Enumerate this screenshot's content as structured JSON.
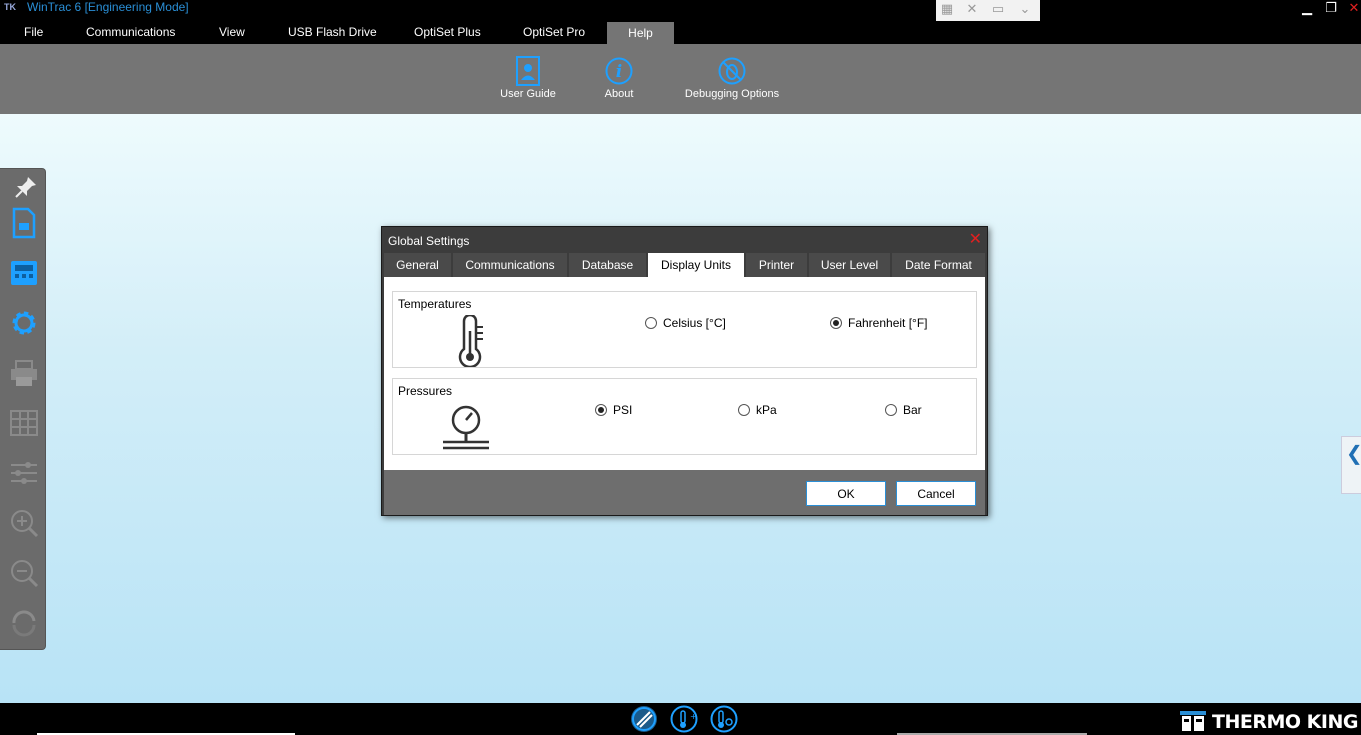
{
  "window": {
    "title": "WinTrac 6 [Engineering Mode]",
    "logo": "TK",
    "quick_access": [
      "grid-icon",
      "fullscreen-icon",
      "monitor-icon",
      "chevron-down-icon"
    ],
    "controls": {
      "minimize": "▁",
      "maximize": "❐",
      "close": "✕"
    }
  },
  "menu": {
    "items": [
      "File",
      "Communications",
      "View",
      "USB Flash Drive",
      "OptiSet Plus",
      "OptiSet Pro",
      "Help"
    ],
    "active": "Help"
  },
  "ribbon": {
    "buttons": [
      {
        "label": "User Guide",
        "icon": "user-guide-icon"
      },
      {
        "label": "About",
        "icon": "info-icon"
      },
      {
        "label": "Debugging Options",
        "icon": "bug-icon"
      }
    ]
  },
  "toolpanel": {
    "tools": [
      "pin-icon",
      "document-icon",
      "device-icon",
      "settings-icon",
      "printer-icon",
      "grid-icon",
      "sliders-icon",
      "zoom-in-icon",
      "zoom-out-icon",
      "refresh-icon"
    ]
  },
  "dialog": {
    "title": "Global Settings",
    "close": "✕",
    "tabs": [
      "General",
      "Communications",
      "Database",
      "Display Units",
      "Printer",
      "User Level",
      "Date Format"
    ],
    "active_tab": "Display Units",
    "temperatures": {
      "label": "Temperatures",
      "icon": "thermometer-icon",
      "options": [
        {
          "label": "Celsius [°C]",
          "checked": false
        },
        {
          "label": "Fahrenheit [°F]",
          "checked": true
        }
      ]
    },
    "pressures": {
      "label": "Pressures",
      "icon": "pressure-gauge-icon",
      "options": [
        {
          "label": "PSI",
          "checked": true
        },
        {
          "label": "kPa",
          "checked": false
        },
        {
          "label": "Bar",
          "checked": false
        }
      ]
    },
    "ok_label": "OK",
    "cancel_label": "Cancel"
  },
  "side_tab": {
    "glyph": "❮"
  },
  "bottom": {
    "icons": [
      "handshake-icon",
      "thermometer-plus-icon",
      "thermometer-settings-icon"
    ],
    "brand": "THERMO KING"
  },
  "colors": {
    "accent": "#2a8fd6",
    "ribbon": "#757575",
    "dialog_bg": "#3c3c3c",
    "close_red": "#e02020"
  }
}
